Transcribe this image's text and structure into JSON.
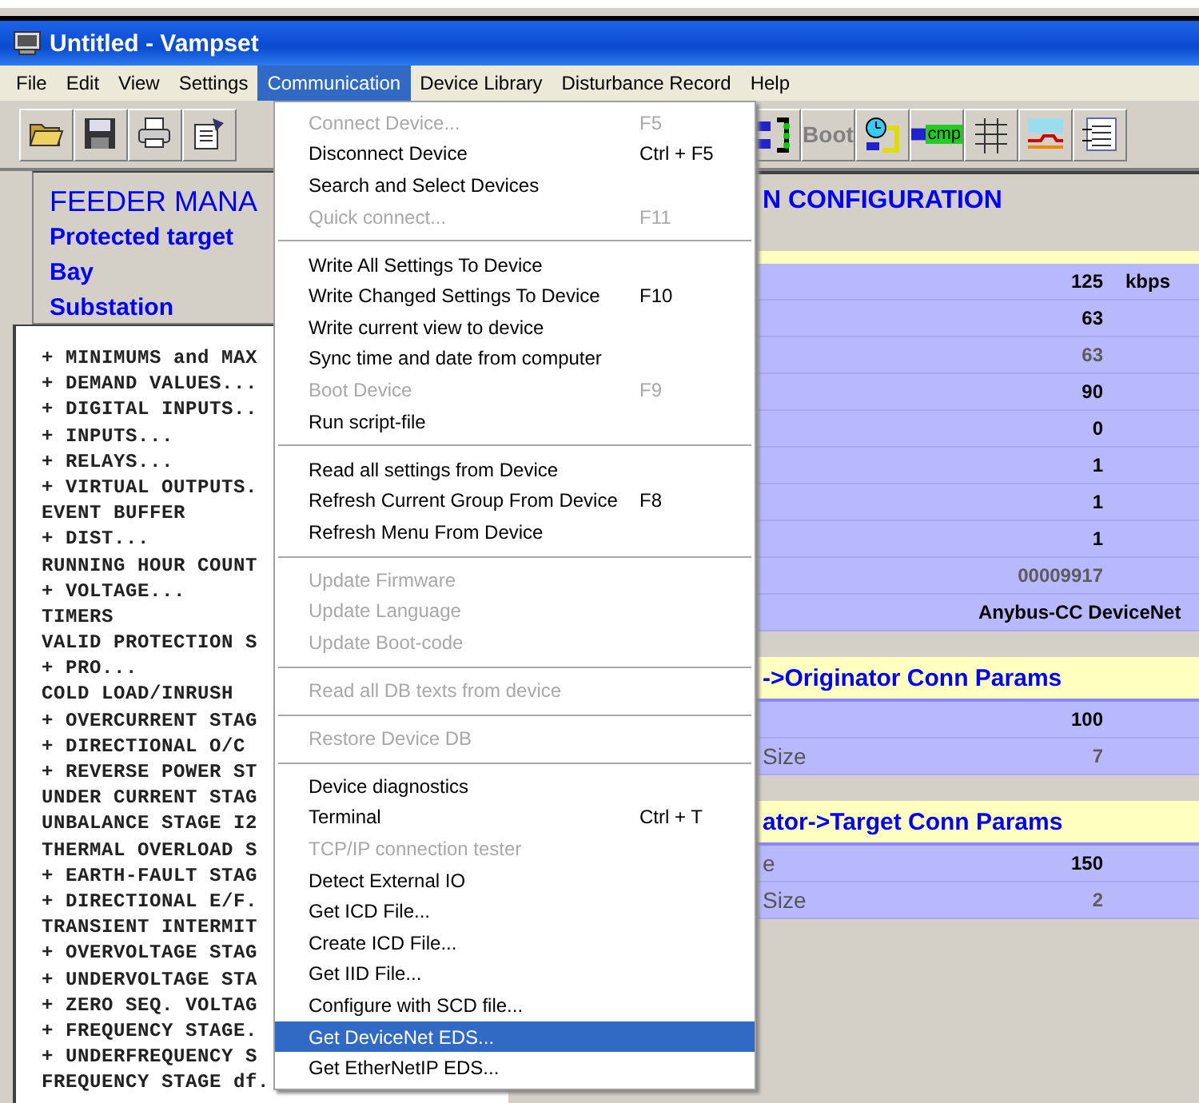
{
  "window": {
    "title": "Untitled - Vampset"
  },
  "menu_bar": [
    {
      "label": "File",
      "selected": false
    },
    {
      "label": "Edit",
      "selected": false
    },
    {
      "label": "View",
      "selected": false
    },
    {
      "label": "Settings",
      "selected": false
    },
    {
      "label": "Communication",
      "selected": true
    },
    {
      "label": "Device Library",
      "selected": false
    },
    {
      "label": "Disturbance Record",
      "selected": false
    },
    {
      "label": "Help",
      "selected": false
    }
  ],
  "toolbar": {
    "left": [
      {
        "kind": "open"
      },
      {
        "kind": "save"
      },
      {
        "kind": "print"
      },
      {
        "kind": "properties"
      }
    ],
    "right": [
      {
        "kind": "transfer"
      },
      {
        "kind": "boot",
        "label": "Boot",
        "disabled": true
      },
      {
        "kind": "clock"
      },
      {
        "kind": "compare",
        "label": "cmp"
      },
      {
        "kind": "grid"
      },
      {
        "kind": "chart"
      },
      {
        "kind": "list"
      }
    ]
  },
  "header": {
    "title": "FEEDER MANA",
    "lines": [
      "Protected target",
      "Bay",
      "Substation"
    ]
  },
  "tree": [
    "+ MINIMUMS and MAX",
    "+ DEMAND VALUES...",
    "+ DIGITAL INPUTS..",
    "+ INPUTS...",
    "+ RELAYS...",
    "+ VIRTUAL OUTPUTS.",
    "EVENT BUFFER",
    "+ DIST...",
    "RUNNING HOUR COUNT",
    "+ VOLTAGE...",
    "TIMERS",
    "VALID PROTECTION S",
    "+ PRO...",
    "COLD LOAD/INRUSH",
    "+ OVERCURRENT STAG",
    "+ DIRECTIONAL O/C",
    "+ REVERSE POWER ST",
    "UNDER CURRENT STAG",
    "UNBALANCE STAGE I2",
    "THERMAL OVERLOAD S",
    "+ EARTH-FAULT STAG",
    "+ DIRECTIONAL E/F.",
    "TRANSIENT INTERMIT",
    "+ OVERVOLTAGE STAG",
    "+ UNDERVOLTAGE STA",
    "+ ZERO SEQ. VOLTAG",
    "+ FREQUENCY STAGE.",
    "+ UNDERFREQUENCY S",
    "FREQUENCY STAGE df."
  ],
  "config": {
    "title": "N CONFIGURATION",
    "rows": [
      {
        "value": "125",
        "unit": "kbps",
        "disabled": false
      },
      {
        "value": "63",
        "disabled": false
      },
      {
        "value": "63",
        "disabled": true
      },
      {
        "value": "90",
        "disabled": false
      },
      {
        "value": "0",
        "disabled": false
      },
      {
        "value": "1",
        "disabled": false
      },
      {
        "value": "1",
        "disabled": false
      },
      {
        "value": "1",
        "disabled": false
      },
      {
        "value": "00009917",
        "disabled": true
      },
      {
        "value": "Anybus-CC DeviceNet",
        "disabled": false
      }
    ],
    "sections": [
      {
        "title": "->Originator Conn Params",
        "rows": [
          {
            "value": "100",
            "disabled": false
          },
          {
            "label": "Size",
            "value": "7",
            "disabled": true
          }
        ]
      },
      {
        "title": "ator->Target Conn Params",
        "rows": [
          {
            "label": "e",
            "value": "150",
            "disabled": false
          },
          {
            "label": "Size",
            "value": "2",
            "disabled": true
          }
        ]
      }
    ]
  },
  "menu": {
    "items": [
      {
        "kind": "item",
        "label": "Connect Device...",
        "shortcut": "F5",
        "disabled": true,
        "selected": false
      },
      {
        "kind": "item",
        "label": "Disconnect Device",
        "shortcut": "Ctrl + F5",
        "disabled": false,
        "selected": false
      },
      {
        "kind": "item",
        "label": "Search and Select Devices",
        "disabled": false,
        "selected": false
      },
      {
        "kind": "item",
        "label": "Quick connect...",
        "shortcut": "F11",
        "disabled": true,
        "selected": false
      },
      {
        "kind": "separator"
      },
      {
        "kind": "item",
        "label": "Write All Settings To Device",
        "disabled": false,
        "selected": false
      },
      {
        "kind": "item",
        "label": "Write Changed Settings To Device",
        "shortcut": "F10",
        "disabled": false,
        "selected": false
      },
      {
        "kind": "item",
        "label": "Write current view to device",
        "disabled": false,
        "selected": false
      },
      {
        "kind": "item",
        "label": "Sync time and date from computer",
        "disabled": false,
        "selected": false
      },
      {
        "kind": "item",
        "label": "Boot Device",
        "shortcut": "F9",
        "disabled": true,
        "selected": false
      },
      {
        "kind": "item",
        "label": "Run script-file",
        "disabled": false,
        "selected": false
      },
      {
        "kind": "separator"
      },
      {
        "kind": "item",
        "label": "Read all settings from Device",
        "disabled": false,
        "selected": false
      },
      {
        "kind": "item",
        "label": "Refresh Current Group From Device",
        "shortcut": "F8",
        "disabled": false,
        "selected": false
      },
      {
        "kind": "item",
        "label": "Refresh Menu From Device",
        "disabled": false,
        "selected": false
      },
      {
        "kind": "separator"
      },
      {
        "kind": "item",
        "label": "Update Firmware",
        "disabled": true,
        "selected": false
      },
      {
        "kind": "item",
        "label": "Update Language",
        "disabled": true,
        "selected": false
      },
      {
        "kind": "item",
        "label": "Update Boot-code",
        "disabled": true,
        "selected": false
      },
      {
        "kind": "separator"
      },
      {
        "kind": "item",
        "label": "Read all DB texts from device",
        "disabled": true,
        "selected": false
      },
      {
        "kind": "separator"
      },
      {
        "kind": "item",
        "label": "Restore Device DB",
        "disabled": true,
        "selected": false
      },
      {
        "kind": "separator"
      },
      {
        "kind": "item",
        "label": "Device diagnostics",
        "disabled": false,
        "selected": false
      },
      {
        "kind": "item",
        "label": "Terminal",
        "shortcut": "Ctrl + T",
        "disabled": false,
        "selected": false
      },
      {
        "kind": "item",
        "label": "TCP/IP connection tester",
        "disabled": true,
        "selected": false
      },
      {
        "kind": "item",
        "label": "Detect External IO",
        "disabled": false,
        "selected": false
      },
      {
        "kind": "item",
        "label": "Get ICD File...",
        "disabled": false,
        "selected": false
      },
      {
        "kind": "item",
        "label": "Create ICD File...",
        "disabled": false,
        "selected": false
      },
      {
        "kind": "item",
        "label": "Get IID File...",
        "disabled": false,
        "selected": false
      },
      {
        "kind": "item",
        "label": "Configure with SCD file...",
        "disabled": false,
        "selected": false
      },
      {
        "kind": "item",
        "label": "Get DeviceNet EDS...",
        "disabled": false,
        "selected": true
      },
      {
        "kind": "item",
        "label": "Get EtherNetIP EDS...",
        "disabled": false,
        "selected": false
      }
    ]
  }
}
